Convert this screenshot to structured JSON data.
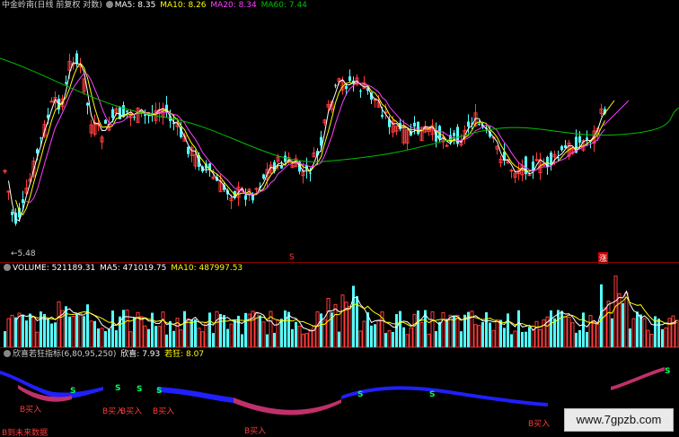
{
  "kline": {
    "title": "中金岭南(日线 前复权 对数)",
    "ma5": "MA5: 8.35",
    "ma10": "MA10: 8.26",
    "ma20": "MA20: 8.34",
    "ma60": "MA60: 7.44",
    "low_label": "5.48",
    "marker_s": "S",
    "marker_zhang": "涨",
    "colors": {
      "up": "#ff3b3b",
      "down": "#54ffff",
      "ma5": "#ffffff",
      "ma10": "#ffff00",
      "ma20": "#ff40ff",
      "ma60": "#00c000",
      "text": "#cccccc"
    }
  },
  "volume": {
    "label": "VOLUME: 521189.31",
    "ma5": "MA5: 471019.75",
    "ma10": "MA10: 487997.53"
  },
  "indicator": {
    "title": "欣喜若狂指标(6,80,95,250)",
    "xinxi": "欣喜: 7.93",
    "ruokuang": "若狂: 8.07",
    "s_markers": [
      "S",
      "S",
      "S",
      "S",
      "S",
      "S",
      "S",
      "S"
    ],
    "buy_markers": [
      "B买入",
      "B买入",
      "B买入",
      "B买入",
      "B买入",
      "B买入"
    ],
    "footer": "B到未来数据"
  },
  "watermark": "www.7gpzb.com"
}
